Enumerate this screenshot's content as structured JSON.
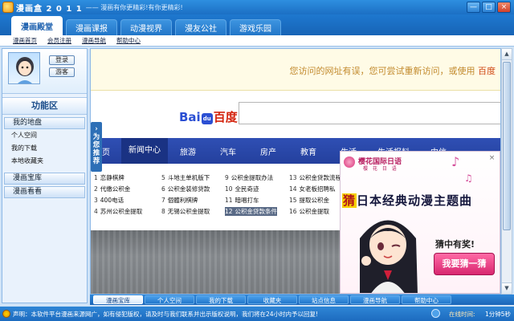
{
  "app": {
    "title": "漫画盒 2 0 1 1",
    "slogan": "—— 漫画有你更精彩!有你更精彩!"
  },
  "window_controls": {
    "minimize": "—",
    "restore": "□",
    "close": "×"
  },
  "tabs": [
    {
      "label": "漫画殿堂",
      "active": true
    },
    {
      "label": "漫画课报",
      "active": false
    },
    {
      "label": "动漫视界",
      "active": false
    },
    {
      "label": "漫友公社",
      "active": false
    },
    {
      "label": "游戏乐园",
      "active": false
    }
  ],
  "subnav": [
    "漫画首页",
    "会员注册",
    "漫画导航",
    "帮助中心"
  ],
  "sidebar": {
    "login_button": "登录",
    "guest_button": "游客",
    "func_title": "功能区",
    "my_area": "我的地盘",
    "my_items": [
      "个人空间",
      "我的下载",
      "本地收藏夹"
    ],
    "comic_library": "漫画宝库",
    "comic_watch": "漫画看看",
    "toggle_label": "为您推荐"
  },
  "browser": {
    "error_msg": "您访问的网址有误，您可尝试重新访问，或使用 ",
    "error_brand": "百度",
    "baidu_logo_left": "Bai",
    "baidu_paw": "du",
    "baidu_logo_right": "百度",
    "news_nav": [
      "首页",
      "新闻中心",
      "旅游",
      "汽车",
      "房产",
      "教育",
      "生活",
      "生活报料",
      "中信"
    ],
    "links": [
      {
        "num": "1",
        "text": "恋静棋牌"
      },
      {
        "num": "2",
        "text": "代缴公积金"
      },
      {
        "num": "3",
        "text": "400电话"
      },
      {
        "num": "4",
        "text": "苏州公积金提取"
      },
      {
        "num": "5",
        "text": "斗地主单机版下"
      },
      {
        "num": "6",
        "text": "公积金装修贷款"
      },
      {
        "num": "7",
        "text": "個體利棋牌"
      },
      {
        "num": "8",
        "text": "无锡公积金提取"
      },
      {
        "num": "9",
        "text": "公积金提取办法"
      },
      {
        "num": "10",
        "text": "全民奇迹"
      },
      {
        "num": "11",
        "text": "暗唱打车"
      },
      {
        "num": "12",
        "text": "公积金贷款条件"
      },
      {
        "num": "13",
        "text": "公积金贷款流程"
      },
      {
        "num": "14",
        "text": "女老板招聘私"
      },
      {
        "num": "15",
        "text": "提取公积金"
      },
      {
        "num": "16",
        "text": "公积金提取"
      }
    ]
  },
  "popup": {
    "close": "×",
    "brand": "樱花国际日语",
    "sub": "樱 花 日 语",
    "guess": "猜",
    "headline_rest": "日本经典动漫主题曲",
    "reward": "猜中有奖!",
    "button": "我要猜一猜"
  },
  "bottom_tabs": [
    {
      "label": "漫画宝库",
      "active": true
    },
    {
      "label": "个人空间",
      "active": false
    },
    {
      "label": "我的下载",
      "active": false
    },
    {
      "label": "收藏夹",
      "active": false
    },
    {
      "label": "站点信息",
      "active": false
    },
    {
      "label": "漫画导航",
      "active": false
    },
    {
      "label": "帮助中心",
      "active": false
    }
  ],
  "status": {
    "notice": "声明：本软件平台漫画来源网广，如有侵犯版权，请及时与我们联系并出示版权说明，我们将在24小时内予以回复!",
    "timer_label": "在线时间:",
    "timer_value": "1分钟5秒"
  }
}
